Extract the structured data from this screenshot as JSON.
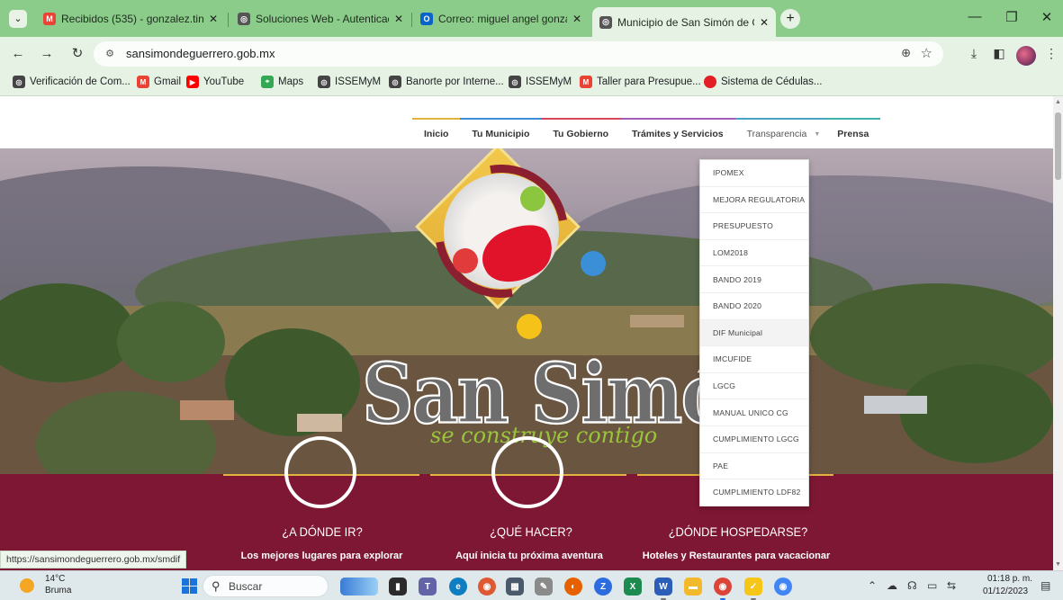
{
  "browser": {
    "tabs": [
      {
        "title": "Recibidos (535) - gonzalez.tino",
        "icon": "gmail-icon",
        "active": false
      },
      {
        "title": "Soluciones Web - Autenticación",
        "icon": "globe-icon",
        "active": false
      },
      {
        "title": "Correo: miguel angel gonzalez",
        "icon": "outlook-icon",
        "active": false
      },
      {
        "title": "Municipio de San Simón de Gu",
        "icon": "globe-icon",
        "active": true
      }
    ],
    "new_tab": "+",
    "url": "sansimondeguerrero.gob.mx",
    "bookmarks": [
      {
        "label": "Verificación de Com...",
        "color": "#444444"
      },
      {
        "label": "Gmail",
        "color": "#ea4335"
      },
      {
        "label": "YouTube",
        "color": "#ff0000"
      },
      {
        "label": "Maps",
        "color": "#34a853"
      },
      {
        "label": "ISSEMyM",
        "color": "#444444"
      },
      {
        "label": "Banorte por Interne...",
        "color": "#444444"
      },
      {
        "label": "ISSEMyM",
        "color": "#444444"
      },
      {
        "label": "Taller para Presupue...",
        "color": "#ea4335"
      },
      {
        "label": "Sistema de Cédulas...",
        "color": "#e31e24"
      }
    ]
  },
  "site": {
    "nav": [
      {
        "label": "Inicio",
        "color": "#e2b23f"
      },
      {
        "label": "Tu Municipio",
        "color": "#3a8fd6"
      },
      {
        "label": "Tu Gobierno",
        "color": "#d6455a"
      },
      {
        "label": "Trámites y Servicios",
        "color": "#a35ab8"
      },
      {
        "label": "Transparencia",
        "color": "#4aa3c7"
      },
      {
        "label": "Prensa",
        "color": "#3bb3a8"
      }
    ],
    "brand": "San Simón",
    "tagline": "se construye contigo",
    "dropdown": [
      "IPOMEX",
      "MEJORA REGULATORIA",
      "PRESUPUESTO",
      "LOM2018",
      "BANDO 2019",
      "BANDO 2020",
      "DIF Municipal",
      "IMCUFIDE",
      "LGCG",
      "MANUAL UNICO CG",
      "CUMPLIMIENTO LGCG",
      "PAE",
      "CUMPLIMIENTO LDF82"
    ],
    "features": [
      {
        "title": "¿A DÓNDE IR?",
        "subtitle": "Los mejores lugares para explorar"
      },
      {
        "title": "¿QUÉ HACER?",
        "subtitle": "Aquí inicia tu próxima aventura"
      },
      {
        "title": "¿DÓNDE HOSPEDARSE?",
        "subtitle": "Hoteles y Restaurantes para vacacionar"
      }
    ],
    "status_url": "https://sansimondeguerrero.gob.mx/smdif"
  },
  "taskbar": {
    "temp": "14°C",
    "weather": "Bruma",
    "search": "Buscar",
    "time": "01:18 p. m.",
    "date": "01/12/2023"
  },
  "colors": {
    "band": "#7e1733",
    "accent_gold": "#e2b23f",
    "chrome_green": "#8ccc8a"
  }
}
